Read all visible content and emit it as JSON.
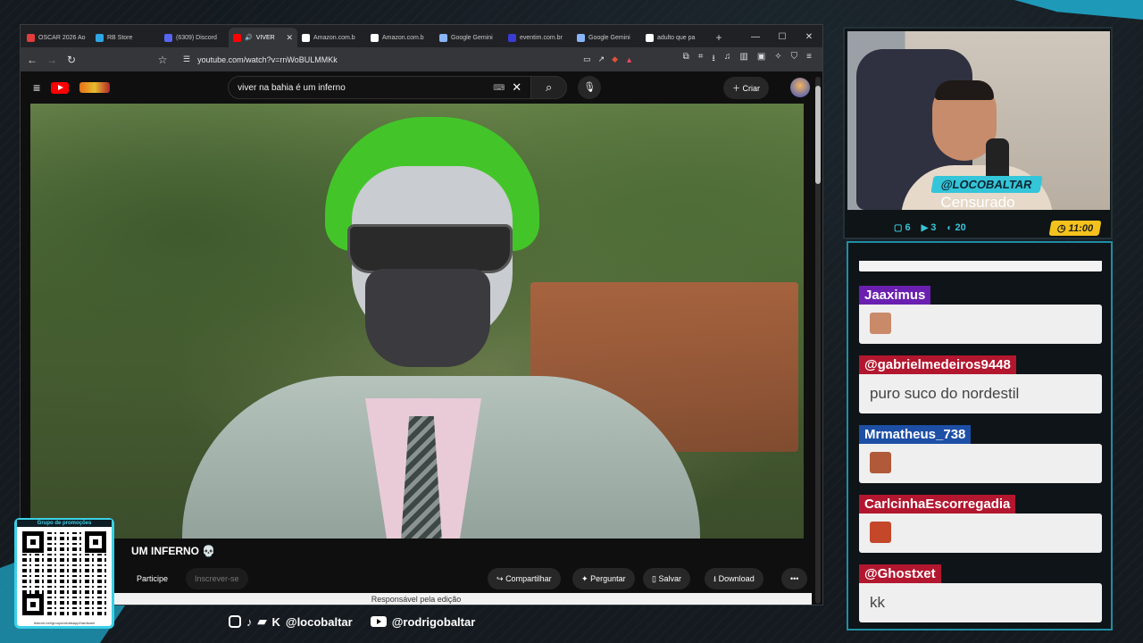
{
  "browser": {
    "tabs": [
      {
        "label": "OSCAR 2026 Ao",
        "color": "#e23c3c"
      },
      {
        "label": "RB Store",
        "color": "#2ea6e6"
      },
      {
        "label": "(6309) Discord",
        "color": "#5865f2"
      },
      {
        "label": "VIVER",
        "color": "#ff0000",
        "active": true
      },
      {
        "label": "Amazon.com.b",
        "color": "#ffffff"
      },
      {
        "label": "Amazon.com.b",
        "color": "#ffffff"
      },
      {
        "label": "Google Gemini",
        "color": "#8ab4f8"
      },
      {
        "label": "eventim.com.br",
        "color": "#3b3bd6"
      },
      {
        "label": "Google Gemini",
        "color": "#8ab4f8"
      },
      {
        "label": "adulto que pa",
        "color": "#ffffff"
      }
    ],
    "url": "youtube.com/watch?v=rnWoBULMMKk"
  },
  "youtube": {
    "search_query": "viver na bahia é um inferno",
    "create_label": "Criar",
    "video_title": "UM INFERNO 💀",
    "join_label": "Participe",
    "subscribe_label": "Inscrever-se",
    "share_label": "Compartilhar",
    "ask_label": "Perguntar",
    "save_label": "Salvar",
    "download_label": "Download",
    "footer_text": "Responsável pela edição"
  },
  "stream": {
    "handle": "@LOCOBALTAR",
    "status": "Censurado",
    "stats": {
      "chat": "6",
      "youtube": "3",
      "twitch": "20",
      "timer": "11:00"
    },
    "accent": "#38c4d8",
    "timer_color": "#f3c21c"
  },
  "chat": [
    {
      "user": "Jaaximus",
      "color": "#6a1fb0",
      "text": "",
      "emote": "#c98a6a"
    },
    {
      "user": "@gabrielmedeiros9448",
      "color": "#b3162f",
      "text": "puro suco do nordestil",
      "emote": ""
    },
    {
      "user": "Mrmatheus_738",
      "color": "#1d4fa6",
      "text": "",
      "emote": "#b05a3a"
    },
    {
      "user": "CarlcinhaEscorregadia",
      "color": "#b3162f",
      "text": "",
      "emote": "#c4472a"
    },
    {
      "user": "@Ghostxet",
      "color": "#b3162f",
      "text": "kk",
      "emote": ""
    }
  ],
  "promo": {
    "label": "Grupo de promoções",
    "url": "rbstore.net/groups/whatsapp/hardware"
  },
  "socials": {
    "handle1": "@locobaltar",
    "handle2": "@rodrigobaltar"
  }
}
